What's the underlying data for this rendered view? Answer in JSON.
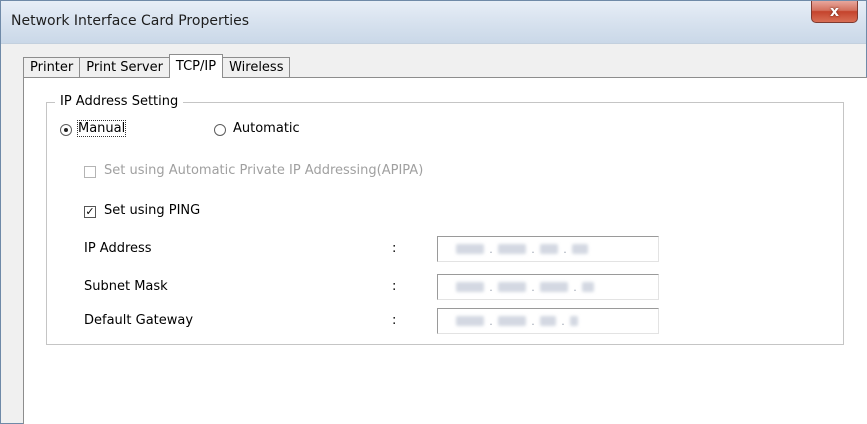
{
  "window": {
    "title": "Network Interface Card Properties",
    "close_label": "x"
  },
  "tabs": [
    {
      "label": "Printer"
    },
    {
      "label": "Print Server"
    },
    {
      "label": "TCP/IP",
      "active": true
    },
    {
      "label": "Wireless"
    }
  ],
  "ip_setting": {
    "group_label": "IP Address Setting",
    "manual_label": "Manual",
    "automatic_label": "Automatic",
    "selected": "Manual",
    "apipa_label": "Set using Automatic Private IP Addressing(APIPA)",
    "apipa_checked": false,
    "ping_label": "Set using PING",
    "ping_checked": true,
    "check_mark": "✓"
  },
  "fields": {
    "ip_address_label": "IP Address",
    "subnet_mask_label": "Subnet Mask",
    "default_gateway_label": "Default Gateway",
    "colon": ":",
    "separator": "."
  }
}
